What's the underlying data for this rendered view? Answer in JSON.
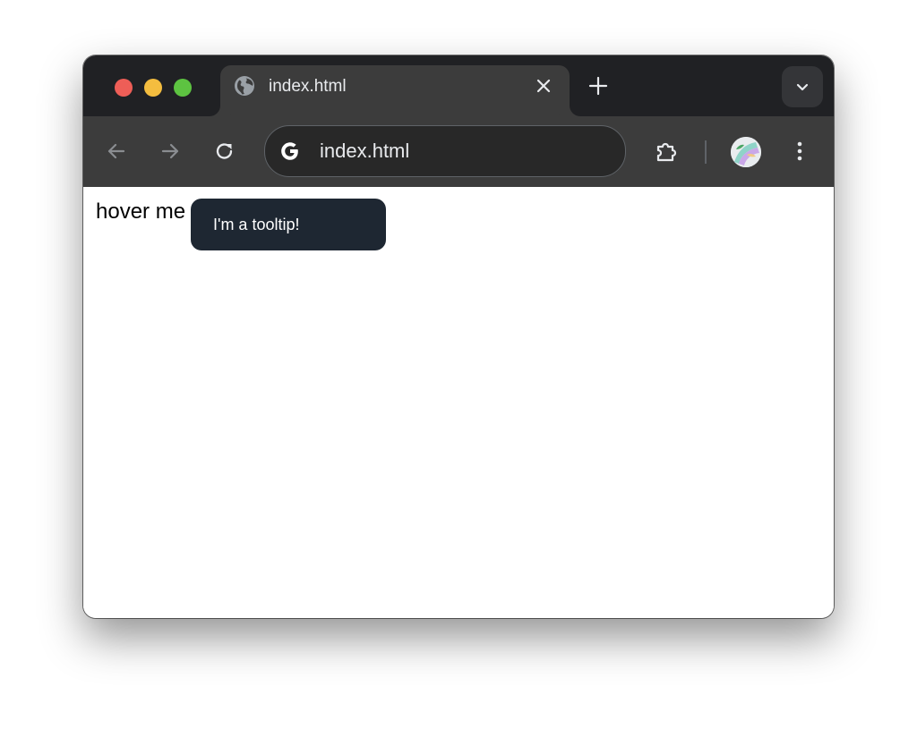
{
  "browser": {
    "tab": {
      "title": "index.html",
      "favicon": "globe-icon",
      "close_icon": "close-icon"
    },
    "new_tab_icon": "plus-icon",
    "tab_search_icon": "chevron-down-icon",
    "toolbar": {
      "back_icon": "arrow-left-icon",
      "forward_icon": "arrow-right-icon",
      "reload_icon": "reload-icon",
      "omnibox_icon": "google-g-icon",
      "address": "index.html",
      "extensions_icon": "puzzle-icon",
      "menu_icon": "kebab-menu-icon"
    },
    "colors": {
      "traffic_red": "#ee5e57",
      "traffic_yellow": "#f4bd3f",
      "traffic_green": "#5dc341",
      "tab_strip": "#202124",
      "toolbar": "#3c3c3c"
    }
  },
  "page": {
    "hover_label": "hover me",
    "tooltip": {
      "text": "I'm a tooltip!",
      "background": "#1e2732"
    }
  }
}
